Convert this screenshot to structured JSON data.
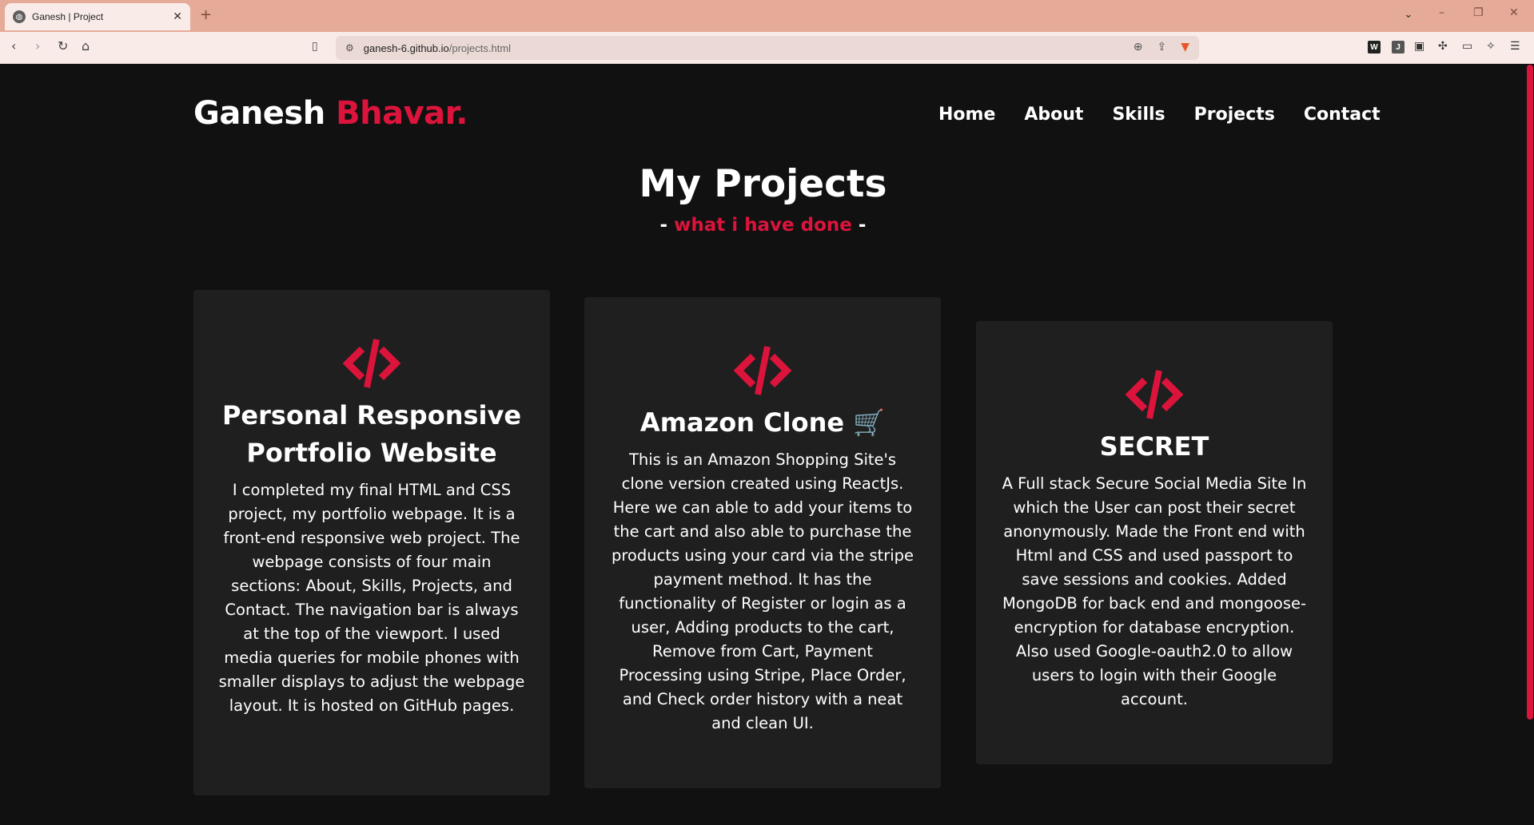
{
  "browser": {
    "tab_title": "Ganesh | Project",
    "url_host": "ganesh-6.github.io",
    "url_path": "/projects.html",
    "extension_w": "W",
    "extension_j": "J"
  },
  "site": {
    "logo_first": "Ganesh ",
    "logo_accent": "Bhavar.",
    "nav": [
      "Home",
      "About",
      "Skills",
      "Projects",
      "Contact"
    ],
    "accent_color": "#dc143c"
  },
  "section": {
    "title": "My Projects",
    "subtitle_dash_left": "- ",
    "subtitle_accent": "what i have done",
    "subtitle_dash_right": " -"
  },
  "projects": [
    {
      "title": "Personal Responsive Portfolio Website",
      "description": "I completed my final HTML and CSS project, my portfolio webpage. It is a front-end responsive web project. The webpage consists of four main sections: About, Skills, Projects, and Contact. The navigation bar is always at the top of the viewport. I used media queries for mobile phones with smaller displays to adjust the webpage layout. It is hosted on GitHub pages."
    },
    {
      "title": "Amazon Clone 🛒",
      "description": "This is an Amazon Shopping Site's clone version created using ReactJs. Here we can able to add your items to the cart and also able to purchase the products using your card via the stripe payment method. It has the functionality of Register or login as a user, Adding products to the cart, Remove from Cart, Payment Processing using Stripe, Place Order, and Check order history with a neat and clean UI."
    },
    {
      "title": "SECRET",
      "description": "A Full stack Secure Social Media Site In which the User can post their secret anonymously. Made the Front end with Html and CSS and used passport to save sessions and cookies. Added MongoDB for back end and mongoose-encryption for database encryption. Also used Google-oauth2.0 to allow users to login with their Google account."
    }
  ]
}
